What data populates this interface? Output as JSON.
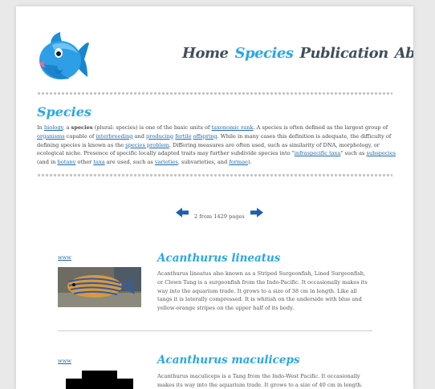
{
  "nav": {
    "items": [
      {
        "label": "Home",
        "active": false
      },
      {
        "label": "Species",
        "active": true
      },
      {
        "label": "Publication",
        "active": false
      },
      {
        "label": "About",
        "active": false
      }
    ]
  },
  "section": {
    "title": "Species",
    "intro": [
      {
        "t": "In "
      },
      {
        "t": "biology",
        "link": true
      },
      {
        "t": ", a "
      },
      {
        "t": "species",
        "bold": true
      },
      {
        "t": " (plural: species) is one of the basic units of "
      },
      {
        "t": "taxonomic rank",
        "link": true
      },
      {
        "t": ". A species is often defined as the largest group of "
      },
      {
        "t": "organisms",
        "link": true
      },
      {
        "t": " capable of "
      },
      {
        "t": "interbreeding",
        "link": true
      },
      {
        "t": " and "
      },
      {
        "t": "producing",
        "link": true
      },
      {
        "t": " "
      },
      {
        "t": "fertile",
        "link": true
      },
      {
        "t": " "
      },
      {
        "t": "offspring",
        "link": true
      },
      {
        "t": ". While in many cases this definition is adequate, the difficulty of defining species is known as the "
      },
      {
        "t": "species problem",
        "link": true
      },
      {
        "t": ". Differing measures are often used, such as similarity of DNA, morphology, or ecological niche. Presence of specific locally adapted traits may further subdivide species into \""
      },
      {
        "t": "infraspecific taxa",
        "link": true
      },
      {
        "t": "\" such as "
      },
      {
        "t": "subspecies",
        "link": true
      },
      {
        "t": " (and in "
      },
      {
        "t": "botany",
        "link": true
      },
      {
        "t": " other "
      },
      {
        "t": "taxa",
        "link": true
      },
      {
        "t": " are used, such as "
      },
      {
        "t": "varieties",
        "link": true
      },
      {
        "t": ", subvarieties, and "
      },
      {
        "t": "formae",
        "link": true
      },
      {
        "t": ")."
      }
    ]
  },
  "pager": {
    "text": "2 from 1429 pages"
  },
  "entries": [
    {
      "link": "www",
      "title": "Acanthurus lineatus",
      "description": "Acanthurus lineatus also known as a Striped Surgeonfish, Lined Surgeonfish, or Clown Tang is a surgeonfish from the Indo-Pacific. It occasionally makes its way into the aquarium trade. It grows to a size of 38 cm in length. Like all tangs it is laterally compressed. It is whitish on the underside with blue and yellow-orange stripes on the upper half of its body."
    },
    {
      "link": "www",
      "title": "Acanthurus maculiceps",
      "description": "Acanthurus maculiceps is a Tang from the Indo-West Pacific. It occasionally makes its way into the aquarium trade. It grows to a size of 40 cm in length."
    }
  ],
  "colors": {
    "accent": "#29a7e6",
    "nav_text": "#3f4f5c",
    "link": "#1e6aa8"
  }
}
